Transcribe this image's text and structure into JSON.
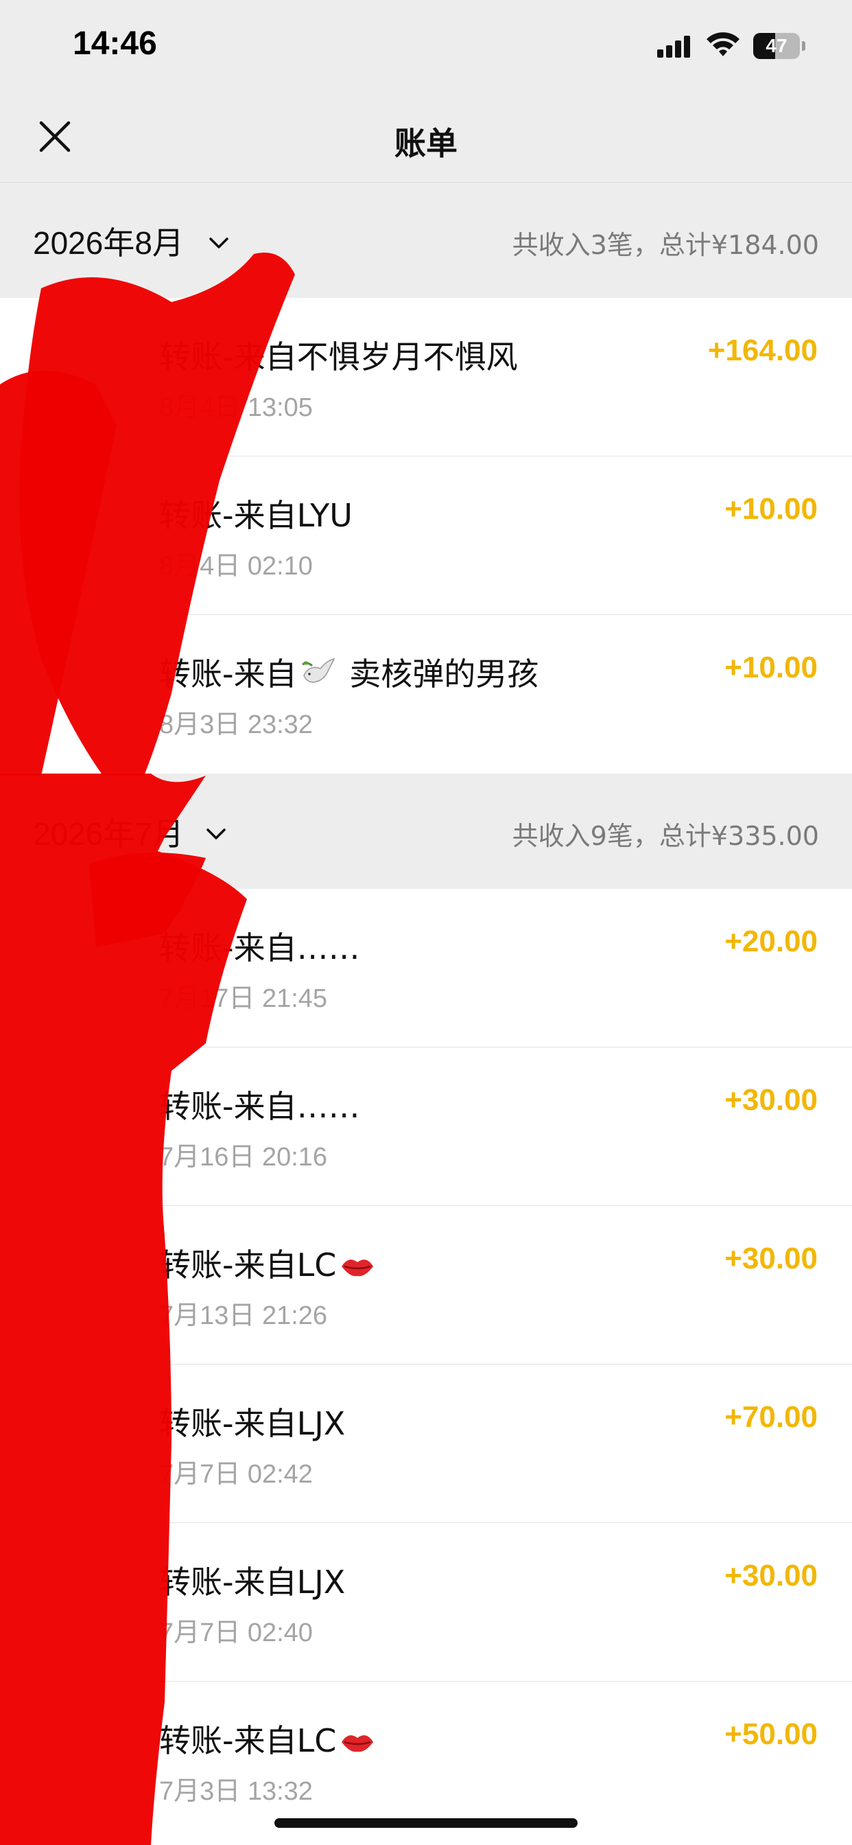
{
  "status_bar": {
    "time": "14:46",
    "battery": "47",
    "battery_level": 0.47
  },
  "header": {
    "title": "账单"
  },
  "months": [
    {
      "title": "2026年8月",
      "summary": "共收入3笔，总计¥184.00",
      "items": [
        {
          "title": "转账-来自不惧岁月不惧风",
          "time": "8月4日 13:05",
          "amount": "+164.00"
        },
        {
          "title": "转账-来自LYU",
          "time": "8月4日 02:10",
          "amount": "+10.00"
        },
        {
          "title_before": "转账-来自",
          "emoji": "dove",
          "title_after": " 卖核弹的男孩",
          "time": "8月3日 23:32",
          "amount": "+10.00"
        }
      ]
    },
    {
      "title": "2026年7月",
      "summary": "共收入9笔，总计¥335.00",
      "items": [
        {
          "title": "转账-来自……",
          "time": "7月17日 21:45",
          "amount": "+20.00"
        },
        {
          "title": "转账-来自……",
          "time": "7月16日 20:16",
          "amount": "+30.00"
        },
        {
          "title": "转账-来自LC",
          "emoji": "kiss-mark",
          "time": "7月13日 21:26",
          "amount": "+30.00"
        },
        {
          "title": "转账-来自LJX",
          "time": "7月7日 02:42",
          "amount": "+70.00"
        },
        {
          "title": "转账-来自LJX",
          "time": "7月7日 02:40",
          "amount": "+30.00"
        },
        {
          "title": "转账-来自LC",
          "emoji": "kiss-mark",
          "time": "7月3日 13:32",
          "amount": "+50.00"
        }
      ]
    }
  ],
  "colors": {
    "amount": "#f2b705",
    "redaction": "#ee0000",
    "header_bg": "#ededed"
  }
}
